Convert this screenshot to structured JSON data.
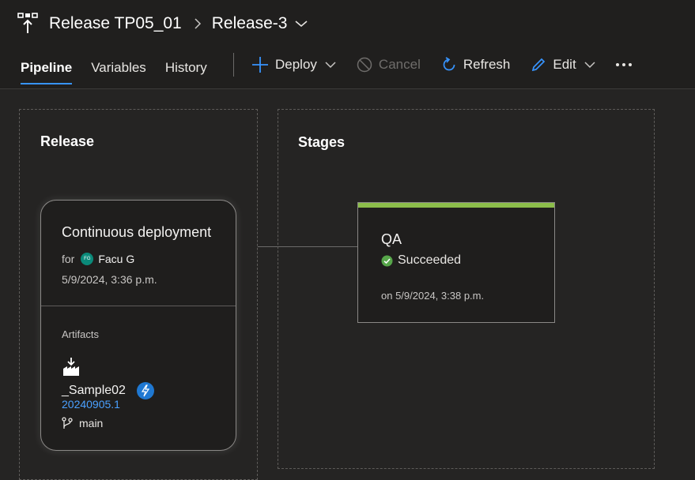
{
  "breadcrumb": {
    "pipeline": "Release TP05_01",
    "release": "Release-3"
  },
  "tabs": [
    {
      "label": "Pipeline",
      "active": true
    },
    {
      "label": "Variables",
      "active": false
    },
    {
      "label": "History",
      "active": false
    }
  ],
  "actions": {
    "deploy": "Deploy",
    "cancel": "Cancel",
    "refresh": "Refresh",
    "edit": "Edit"
  },
  "release_panel": {
    "title": "Release",
    "card": {
      "title": "Continuous deployment",
      "for_label": "for",
      "avatar_initials": "FG",
      "user": "Facu G",
      "date": "5/9/2024, 3:36 p.m.",
      "artifacts_label": "Artifacts",
      "artifact_name": "_Sample02",
      "build": "20240905.1",
      "branch": "main"
    }
  },
  "stages_panel": {
    "title": "Stages",
    "stage": {
      "name": "QA",
      "status": "Succeeded",
      "date": "on 5/9/2024, 3:38 p.m."
    }
  },
  "colors": {
    "accent": "#3794ff",
    "success": "#8cbd4a",
    "success_icon": "#57a64a",
    "link": "#4aa0ff",
    "background": "#252423"
  }
}
